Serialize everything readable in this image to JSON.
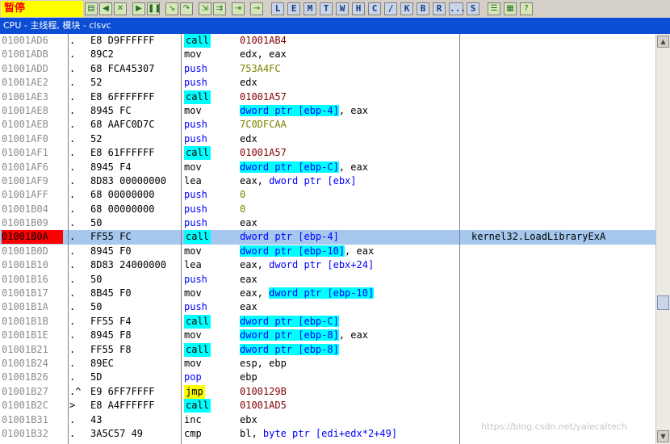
{
  "toolbar": {
    "status": "暂停",
    "icon_buttons": [
      "open-icon",
      "rewind-icon",
      "close-icon",
      "run-icon",
      "pause-icon",
      "step-into-icon",
      "step-over-icon",
      "trace-into-icon",
      "trace-over-icon",
      "execute-till-return-icon",
      "goto-icon"
    ],
    "letter_buttons": [
      "L",
      "E",
      "M",
      "T",
      "W",
      "H",
      "C",
      "/",
      "K",
      "B",
      "R",
      "...",
      "S"
    ],
    "right_icons": [
      "list-icon",
      "grid-icon",
      "help-icon"
    ]
  },
  "title": "CPU - 主线程, 模块 - clsvc",
  "rows": [
    {
      "addr": "01001AD6",
      "mark": ".",
      "hex": "E8 D9FFFFFF",
      "mn": "call",
      "op": [
        {
          "t": "01001AB4",
          "c": "addr"
        }
      ]
    },
    {
      "addr": "01001ADB",
      "mark": ".",
      "hex": "89C2",
      "mn": "mov",
      "op": [
        {
          "t": "edx, eax"
        }
      ]
    },
    {
      "addr": "01001ADD",
      "mark": ".",
      "hex": "68 FCA45307",
      "mn": "push",
      "op": [
        {
          "t": "753A4FC",
          "c": "imm"
        }
      ]
    },
    {
      "addr": "01001AE2",
      "mark": ".",
      "hex": "52",
      "mn": "push",
      "op": [
        {
          "t": "edx"
        }
      ]
    },
    {
      "addr": "01001AE3",
      "mark": ".",
      "hex": "E8 6FFFFFFF",
      "mn": "call",
      "op": [
        {
          "t": "01001A57",
          "c": "addr"
        }
      ]
    },
    {
      "addr": "01001AE8",
      "mark": ".",
      "hex": "8945 FC",
      "mn": "mov",
      "op": [
        {
          "t": "dword ptr [ebp-4]",
          "c": "mem"
        },
        {
          "t": ", eax"
        }
      ]
    },
    {
      "addr": "01001AEB",
      "mark": ".",
      "hex": "68 AAFC0D7C",
      "mn": "push",
      "op": [
        {
          "t": "7C0DFCAA",
          "c": "imm"
        }
      ]
    },
    {
      "addr": "01001AF0",
      "mark": ".",
      "hex": "52",
      "mn": "push",
      "op": [
        {
          "t": "edx"
        }
      ]
    },
    {
      "addr": "01001AF1",
      "mark": ".",
      "hex": "E8 61FFFFFF",
      "mn": "call",
      "op": [
        {
          "t": "01001A57",
          "c": "addr"
        }
      ]
    },
    {
      "addr": "01001AF6",
      "mark": ".",
      "hex": "8945 F4",
      "mn": "mov",
      "op": [
        {
          "t": "dword ptr [ebp-C]",
          "c": "mem"
        },
        {
          "t": ", eax"
        }
      ]
    },
    {
      "addr": "01001AF9",
      "mark": ".",
      "hex": "8D83 00000000",
      "mn": "lea",
      "op": [
        {
          "t": "eax, "
        },
        {
          "t": "dword ptr [ebx]",
          "c": "memp"
        }
      ]
    },
    {
      "addr": "01001AFF",
      "mark": ".",
      "hex": "68 00000000",
      "mn": "push",
      "op": [
        {
          "t": "0",
          "c": "imm"
        }
      ]
    },
    {
      "addr": "01001B04",
      "mark": ".",
      "hex": "68 00000000",
      "mn": "push",
      "op": [
        {
          "t": "0",
          "c": "imm"
        }
      ]
    },
    {
      "addr": "01001B09",
      "mark": ".",
      "hex": "50",
      "mn": "push",
      "op": [
        {
          "t": "eax"
        }
      ]
    },
    {
      "addr": "01001B0A",
      "mark": ".",
      "hex": "FF55 FC",
      "mn": "call",
      "op": [
        {
          "t": "dword ptr [ebp-4]",
          "c": "memp"
        }
      ],
      "comment": "kernel32.LoadLibraryExA",
      "selected": true
    },
    {
      "addr": "01001B0D",
      "mark": ".",
      "hex": "8945 F0",
      "mn": "mov",
      "op": [
        {
          "t": "dword ptr [ebp-10]",
          "c": "mem"
        },
        {
          "t": ", eax"
        }
      ]
    },
    {
      "addr": "01001B10",
      "mark": ".",
      "hex": "8D83 24000000",
      "mn": "lea",
      "op": [
        {
          "t": "eax, "
        },
        {
          "t": "dword ptr [ebx+24]",
          "c": "memp"
        }
      ]
    },
    {
      "addr": "01001B16",
      "mark": ".",
      "hex": "50",
      "mn": "push",
      "op": [
        {
          "t": "eax"
        }
      ]
    },
    {
      "addr": "01001B17",
      "mark": ".",
      "hex": "8B45 F0",
      "mn": "mov",
      "op": [
        {
          "t": "eax, "
        },
        {
          "t": "dword ptr [ebp-10]",
          "c": "mem"
        }
      ]
    },
    {
      "addr": "01001B1A",
      "mark": ".",
      "hex": "50",
      "mn": "push",
      "op": [
        {
          "t": "eax"
        }
      ]
    },
    {
      "addr": "01001B1B",
      "mark": ".",
      "hex": "FF55 F4",
      "mn": "call",
      "op": [
        {
          "t": "dword ptr [ebp-C]",
          "c": "mem"
        }
      ]
    },
    {
      "addr": "01001B1E",
      "mark": ".",
      "hex": "8945 F8",
      "mn": "mov",
      "op": [
        {
          "t": "dword ptr [ebp-8]",
          "c": "mem"
        },
        {
          "t": ", eax"
        }
      ]
    },
    {
      "addr": "01001B21",
      "mark": ".",
      "hex": "FF55 F8",
      "mn": "call",
      "op": [
        {
          "t": "dword ptr [ebp-8]",
          "c": "mem"
        }
      ]
    },
    {
      "addr": "01001B24",
      "mark": ".",
      "hex": "89EC",
      "mn": "mov",
      "op": [
        {
          "t": "esp, ebp"
        }
      ]
    },
    {
      "addr": "01001B26",
      "mark": ".",
      "hex": "5D",
      "mn": "pop",
      "op": [
        {
          "t": "ebp"
        }
      ]
    },
    {
      "addr": "01001B27",
      "mark": ".^",
      "hex": "E9 6FF7FFFF",
      "mn": "jmp",
      "op": [
        {
          "t": "0100129B",
          "c": "addr"
        }
      ]
    },
    {
      "addr": "01001B2C",
      "mark": ">",
      "hex": "E8 A4FFFFFF",
      "mn": "call",
      "op": [
        {
          "t": "01001AD5",
          "c": "addr"
        }
      ]
    },
    {
      "addr": "01001B31",
      "mark": ".",
      "hex": "43",
      "mn": "inc",
      "op": [
        {
          "t": "ebx"
        }
      ]
    },
    {
      "addr": "01001B32",
      "mark": ".",
      "hex": "3A5C57 49",
      "mn": "cmp",
      "op": [
        {
          "t": "bl, "
        },
        {
          "t": "byte ptr [edi+edx*2+49]",
          "c": "memp"
        }
      ]
    }
  ],
  "watermark": "https://blog.csdn.net/yalecaltech"
}
